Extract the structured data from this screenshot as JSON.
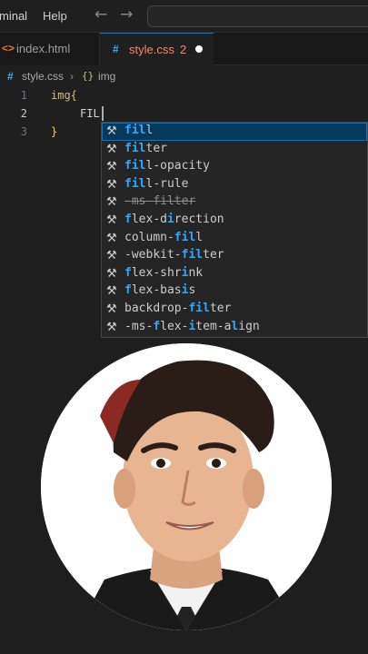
{
  "menubar": {
    "items": [
      "minal",
      "Help"
    ],
    "back_icon": "arrow-left-icon",
    "forward_icon": "arrow-right-icon"
  },
  "tabs": [
    {
      "glyph": "<>",
      "label": "index.html",
      "active": false
    },
    {
      "glyph": "#",
      "label": "style.css",
      "problems": "2",
      "active": true
    }
  ],
  "breadcrumb": {
    "file_glyph": "#",
    "file": "style.css",
    "symbol": "img"
  },
  "editor": {
    "line_numbers": [
      "1",
      "2",
      "3"
    ],
    "lines": [
      "img{",
      "FIL",
      "}"
    ]
  },
  "suggestions": [
    {
      "label": "fill"
    },
    {
      "label": "filter"
    },
    {
      "label": "fill-opacity"
    },
    {
      "label": "fill-rule"
    },
    {
      "label": "-ms-filter",
      "deprecated": true
    },
    {
      "label": "flex-direction"
    },
    {
      "label": "column-fill"
    },
    {
      "label": "-webkit-filter"
    },
    {
      "label": "flex-shrink"
    },
    {
      "label": "flex-basis"
    },
    {
      "label": "backdrop-filter"
    },
    {
      "label": "-ms-flex-item-align"
    }
  ],
  "suggestion_icon": "wrench-icon",
  "colors": {
    "accent": "#0078d4",
    "match": "#2aaaff",
    "selected_row": "#04395e",
    "bracket": "#ffd700",
    "selector": "#d7ba7d",
    "tab_css": "#f48771"
  }
}
